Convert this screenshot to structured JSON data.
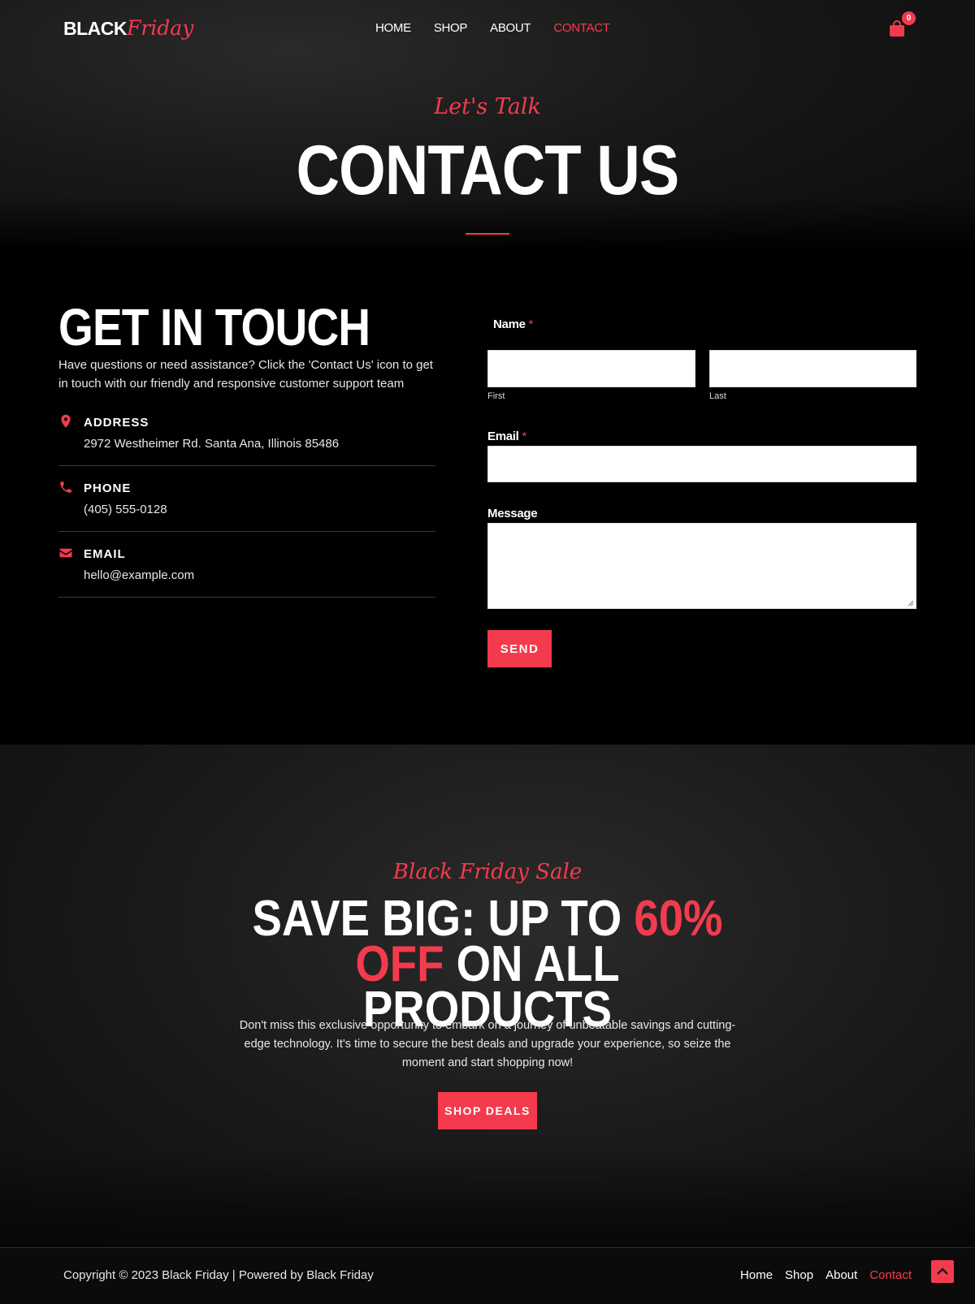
{
  "header": {
    "logo_part1": "BLACK",
    "logo_part2": "Friday",
    "nav": [
      {
        "label": "HOME"
      },
      {
        "label": "SHOP"
      },
      {
        "label": "ABOUT"
      },
      {
        "label": "CONTACT",
        "active": true
      }
    ],
    "cart_count": "0"
  },
  "hero": {
    "kicker": "Let's Talk",
    "title": "CONTACT US"
  },
  "contact": {
    "title": "GET IN TOUCH",
    "description": "Have questions or need assistance? Click the 'Contact Us' icon to get in touch with our friendly and responsive customer support team",
    "items": [
      {
        "icon": "map-pin-icon",
        "label": "ADDRESS",
        "value": "2972 Westheimer Rd. Santa Ana, Illinois 85486"
      },
      {
        "icon": "phone-icon",
        "label": "PHONE",
        "value": "(405) 555-0128"
      },
      {
        "icon": "envelope-icon",
        "label": "EMAIL",
        "value": "hello@example.com"
      }
    ]
  },
  "form": {
    "name_label": "Name",
    "required_mark": "*",
    "first_label": "First",
    "last_label": "Last",
    "email_label": "Email",
    "message_label": "Message",
    "send_label": "SEND"
  },
  "sale": {
    "kicker": "Black Friday Sale",
    "title_part1": "SAVE BIG: UP TO ",
    "title_accent": "60% OFF",
    "title_part2": " ON ALL PRODUCTS",
    "description": "Don't miss this exclusive opportunity to embark on a journey of unbeatable savings and cutting-edge technology. It's time to secure the best deals and upgrade your experience, so seize the moment and start shopping now!",
    "button_label": "SHOP DEALS"
  },
  "footer": {
    "copyright": "Copyright © 2023 Black Friday | Powered by Black Friday",
    "nav": [
      {
        "label": "Home"
      },
      {
        "label": "Shop"
      },
      {
        "label": "About"
      },
      {
        "label": "Contact",
        "active": true
      }
    ]
  },
  "colors": {
    "accent": "#f43b4e",
    "background": "#000000"
  }
}
